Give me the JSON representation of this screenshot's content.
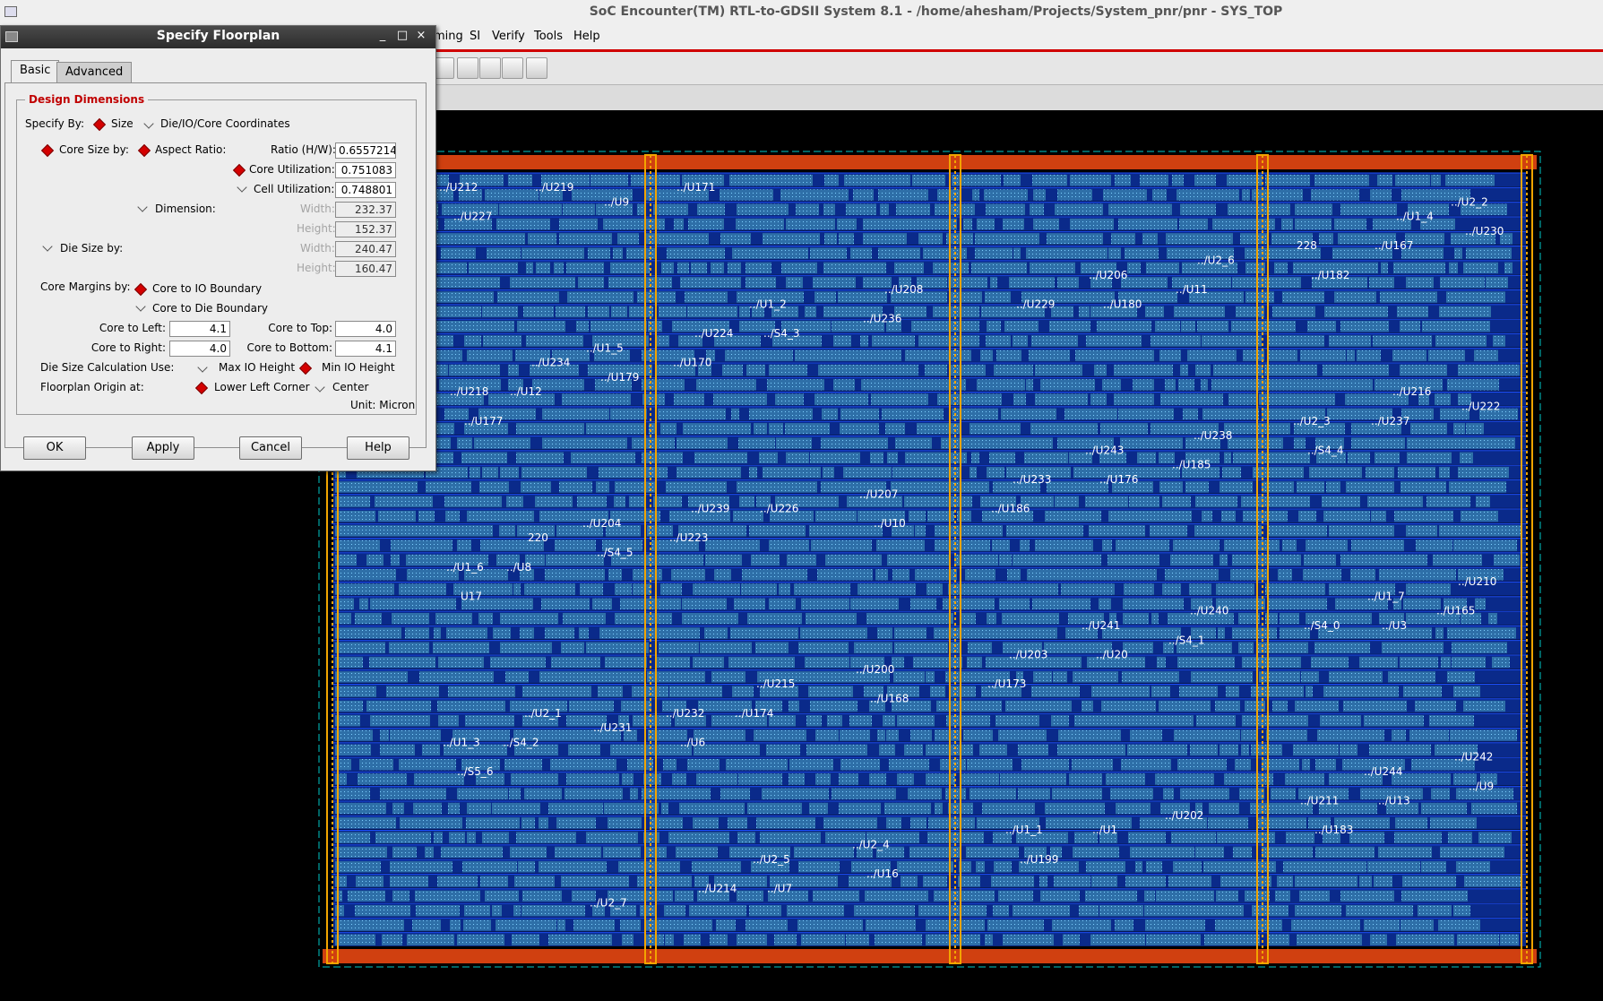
{
  "window": {
    "title": "SoC Encounter(TM) RTL-to-GDSII System 8.1 - /home/ahesham/Projects/System_pnr/pnr - SYS_TOP"
  },
  "menubar": {
    "items": [
      "ming",
      "SI",
      "Verify",
      "Tools",
      "Help"
    ]
  },
  "dialog": {
    "title": "Specify Floorplan",
    "window_buttons": {
      "minimize": "_",
      "maximize": "□",
      "close": "×"
    },
    "tabs": [
      "Basic",
      "Advanced"
    ],
    "active_tab": "Basic",
    "group_title": "Design Dimensions",
    "specify_by_label": "Specify By:",
    "specify_by_options": [
      "Size",
      "Die/IO/Core Coordinates"
    ],
    "specify_by_selected": "Size",
    "core_size_by_label": "Core Size by:",
    "aspect_ratio_label": "Aspect Ratio:",
    "ratio_label": "Ratio (H/W):",
    "ratio_value": "0.65572147",
    "core_util_label": "Core Utilization:",
    "core_util_value": "0.751083",
    "cell_util_label": "Cell Utilization:",
    "cell_util_value": "0.748801",
    "dimension_label": "Dimension:",
    "dim_width_label": "Width:",
    "dim_width_value": "232.37",
    "dim_height_label": "Height:",
    "dim_height_value": "152.37",
    "die_size_label": "Die Size by:",
    "die_width_label": "Width:",
    "die_width_value": "240.47",
    "die_height_label": "Height:",
    "die_height_value": "160.47",
    "core_margins_label": "Core Margins by:",
    "core_to_io_label": "Core to IO Boundary",
    "core_to_die_label": "Core to Die Boundary",
    "core_left_label": "Core to Left:",
    "core_left_value": "4.1",
    "core_top_label": "Core to Top:",
    "core_top_value": "4.0",
    "core_right_label": "Core to Right:",
    "core_right_value": "4.0",
    "core_bottom_label": "Core to Bottom:",
    "core_bottom_value": "4.1",
    "die_calc_label": "Die Size Calculation Use:",
    "max_io_label": "Max IO Height",
    "min_io_label": "Min IO Height",
    "origin_label": "Floorplan Origin at:",
    "lower_left_label": "Lower Left Corner",
    "center_label": "Center",
    "unit_label": "Unit: Micron",
    "buttons": {
      "ok": "OK",
      "apply": "Apply",
      "cancel": "Cancel",
      "help": "Help"
    }
  },
  "layout": {
    "colors": {
      "background": "#000000",
      "row_fill": "#0a2a8a",
      "cell_fill": "#2e6fa8",
      "row_line": "#1d4fff",
      "power_stripe": "#f2a400",
      "ring": "#d04010",
      "boundary": "#00c8c8"
    },
    "cell_labels": [
      "../U212",
      "../U208",
      "../U216",
      "../U239",
      "../U240",
      "../U2_1",
      "../U1_1",
      "../U2_2",
      "../U1_2",
      "../U2_3",
      "../U204",
      "../U241",
      "../U1_3",
      "../U2_4",
      "../U1_4",
      "../U224",
      "../U238",
      "220",
      "../U203",
      "../U242",
      "../U2_5",
      "228",
      "../U1_5",
      "../U243",
      "../U1_6",
      "../U200",
      "../U244",
      "../U214",
      "../U2_6",
      "../U234",
      "../U233",
      "../U210",
      "../U215",
      "../U211",
      "../U2_7",
      "../U206",
      "../U218",
      "../U207",
      "../U1_7",
      "../U232",
      "../U202",
      "../U219",
      "../U229",
      "../U222",
      "../U226",
      "../S4_0",
      "../U231",
      "../U1",
      "../U227",
      "../U236",
      "../U237",
      "../U223",
      "../S4_1",
      "../S4_2",
      "../U199",
      "../U230",
      "../S4_3",
      "../S4_4",
      "../S4_5",
      "../U20",
      "../S5_6",
      "../U16",
      "../U167",
      "../U170",
      "../U185",
      "../U8",
      "../U173",
      "../U9",
      "../U7",
      "../U182",
      "../U179",
      "../U176",
      "U17",
      "../U168",
      "../U13",
      "../U171",
      "../U11",
      "../U12",
      "../U186",
      "../U165",
      "../U174",
      "../U183",
      "../U9",
      "../U180",
      "../U177",
      "../U10",
      "../U3",
      "../U6"
    ]
  }
}
